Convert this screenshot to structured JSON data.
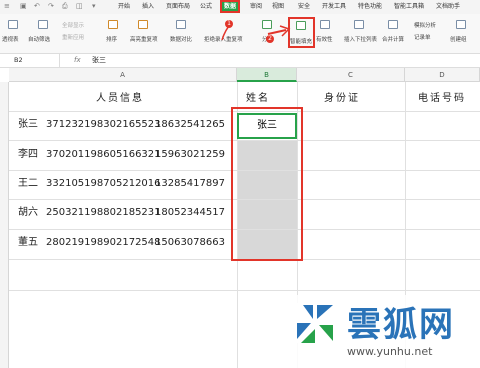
{
  "ribbon": {
    "tabs": [
      "开始",
      "插入",
      "页面布局",
      "公式",
      "数据",
      "审阅",
      "视图",
      "安全",
      "开发工具",
      "特色功能",
      "智能工具箱",
      "文档助手"
    ],
    "active_tab": "数据",
    "buttons": [
      "透视表",
      "自动筛选",
      "全部显示",
      "重新应用",
      "排序",
      "高亮重复项",
      "数据对比",
      "拒绝录入重复项",
      "分列",
      "智能填充",
      "有效性",
      "插入下拉列表",
      "合并计算",
      "模拟分析",
      "记录单",
      "创建组"
    ],
    "highlighted_button": "智能填充",
    "step_badges": [
      "1",
      "2"
    ]
  },
  "formula_bar": {
    "cell_ref": "B2",
    "fx": "fx",
    "value": "张三"
  },
  "columns": [
    "A",
    "B",
    "C",
    "D"
  ],
  "selected_column": "B",
  "headers": {
    "a": "人员信息",
    "b": "姓名",
    "c": "身份证",
    "d": "电话号码"
  },
  "rows": [
    {
      "name": "张三",
      "id": "371232198302165523",
      "phone": "18632541265"
    },
    {
      "name": "李四",
      "id": "370201198605166321",
      "phone": "15963021259"
    },
    {
      "name": "王二",
      "id": "332105198705212016",
      "phone": "13285417897"
    },
    {
      "name": "胡六",
      "id": "250321198802185231",
      "phone": "18052344517"
    },
    {
      "name": "董五",
      "id": "280219198902172548",
      "phone": "15063078663"
    }
  ],
  "b2_value": "张三",
  "watermark": {
    "site": "雲狐网",
    "url": "www.yunhu.net"
  },
  "colors": {
    "accent": "#27a24a",
    "highlight": "#e2352a",
    "selection": "#d8d8d8"
  }
}
